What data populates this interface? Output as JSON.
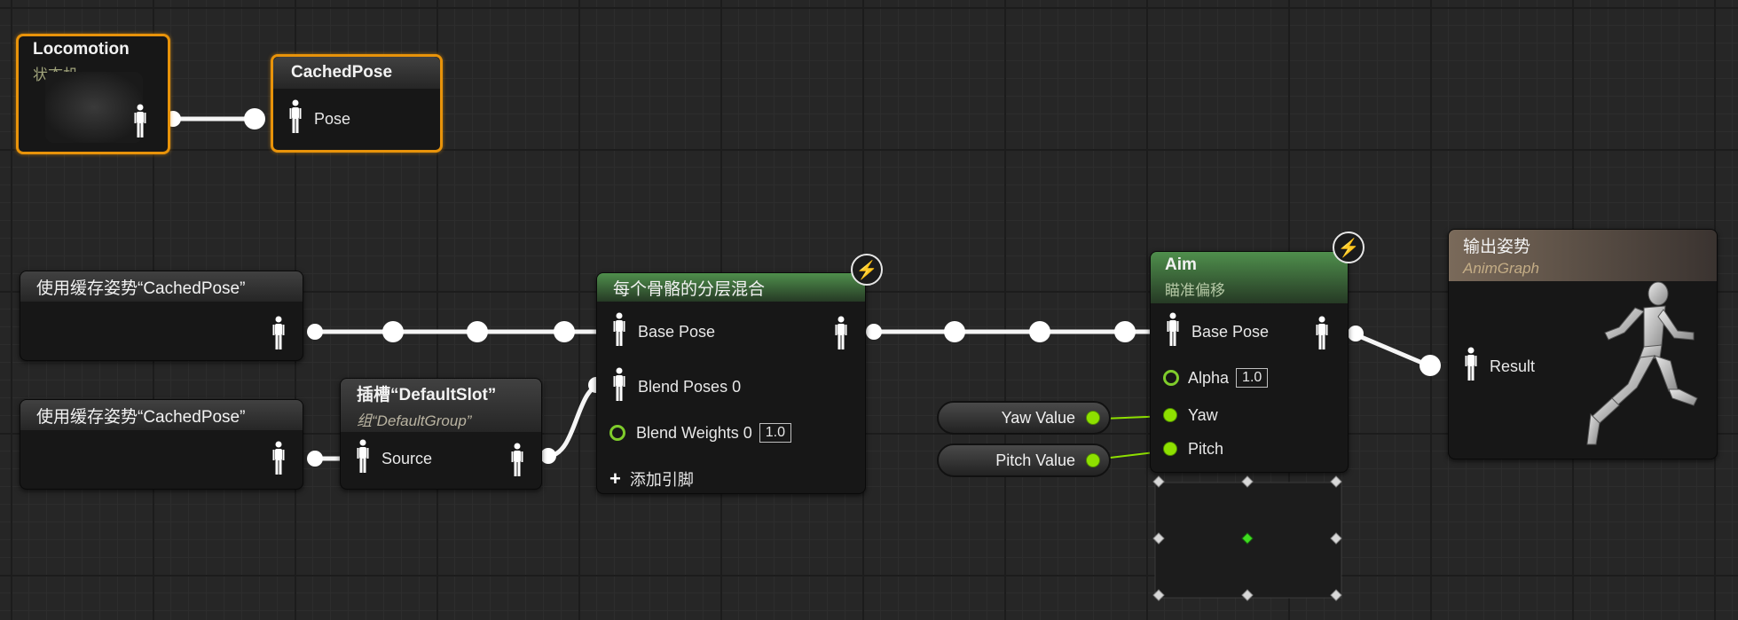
{
  "nodes": {
    "locomotion": {
      "title": "Locomotion",
      "subtitle": "状态机"
    },
    "cached_pose": {
      "title": "CachedPose",
      "pin": "Pose"
    },
    "use_cached_1": {
      "title": "使用缓存姿势“CachedPose”"
    },
    "use_cached_2": {
      "title": "使用缓存姿势“CachedPose”"
    },
    "slot": {
      "title": "插槽“DefaultSlot”",
      "subtitle": "组“DefaultGroup”",
      "pin": "Source"
    },
    "layered_blend": {
      "title": "每个骨骼的分层混合",
      "base_pose": "Base Pose",
      "blend_poses": "Blend Poses 0",
      "blend_weights": "Blend Weights 0",
      "blend_weights_value": "1.0",
      "add_pin": "添加引脚"
    },
    "yaw_value": {
      "label": "Yaw Value"
    },
    "pitch_value": {
      "label": "Pitch Value"
    },
    "aim": {
      "title": "Aim",
      "subtitle": "瞄准偏移",
      "base_pose": "Base Pose",
      "alpha": "Alpha",
      "alpha_value": "1.0",
      "yaw": "Yaw",
      "pitch": "Pitch"
    },
    "output_pose": {
      "title": "输出姿势",
      "subtitle": "AnimGraph",
      "pin": "Result"
    }
  },
  "colors": {
    "selection": "#e8930a",
    "float_pin": "#8ee000",
    "blend_header": "#4f8f4c",
    "output_header": "#7a6a5a"
  },
  "icons": {
    "pose_pin": "person-pose-icon",
    "fast_path": "lightning-icon",
    "add": "plus-icon"
  }
}
